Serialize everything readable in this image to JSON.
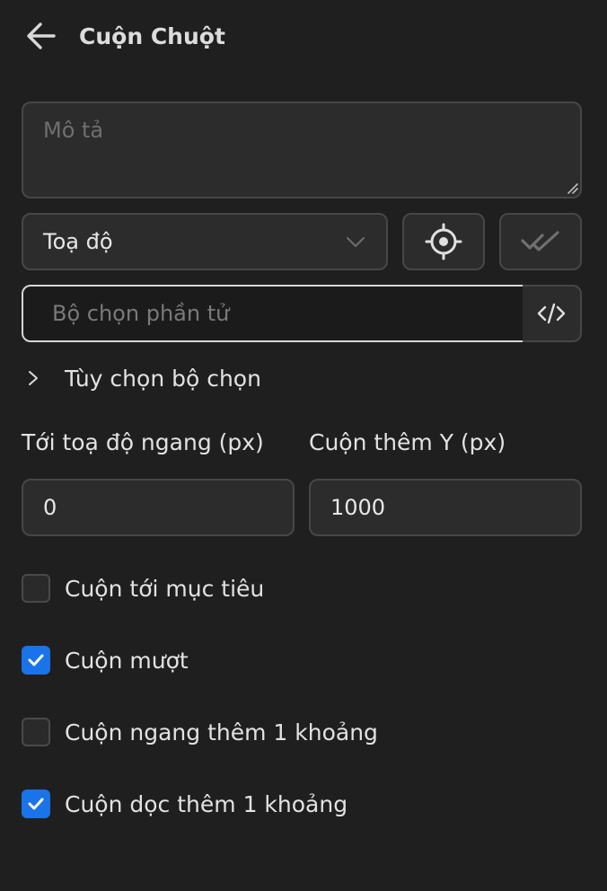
{
  "header": {
    "title": "Cuộn Chuột",
    "back_icon": "arrow-left-icon"
  },
  "description": {
    "value": "",
    "placeholder": "Mô tả"
  },
  "mode_select": {
    "value": "Toạ độ"
  },
  "selector": {
    "value": "",
    "placeholder": "Bộ chọn phần tử"
  },
  "selector_options": {
    "label": "Tùy chọn bộ chọn",
    "expanded": false
  },
  "coords": {
    "x_label": "Tới toạ độ ngang (px)",
    "x_value": "0",
    "y_label": "Cuộn thêm Y (px)",
    "y_value": "1000"
  },
  "options": [
    {
      "label": "Cuộn tới mục tiêu",
      "checked": false
    },
    {
      "label": "Cuộn mượt",
      "checked": true
    },
    {
      "label": "Cuộn ngang thêm 1 khoảng",
      "checked": false
    },
    {
      "label": "Cuộn dọc thêm 1 khoảng",
      "checked": true
    }
  ],
  "colors": {
    "background": "#1f1f1f",
    "accent": "#1a73e8",
    "field": "#2c2c2c",
    "border": "#474747"
  }
}
